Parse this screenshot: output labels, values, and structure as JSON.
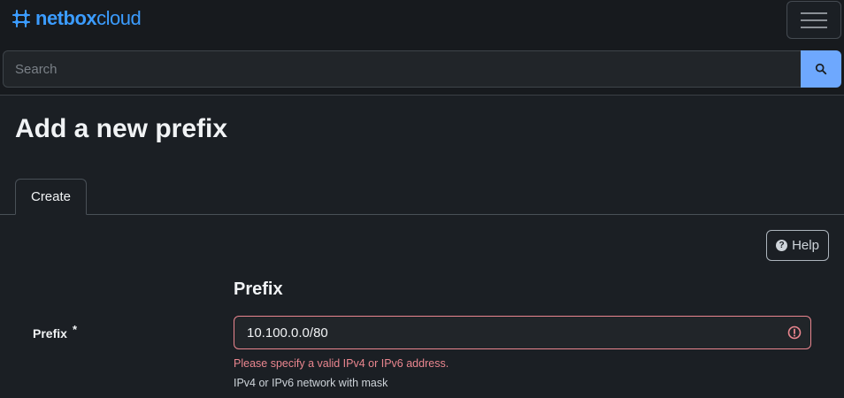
{
  "header": {
    "logo_bold": "netbox",
    "logo_light": "cloud",
    "logo_icon": "netbox-logo-icon",
    "menu_icon": "hamburger-menu-icon"
  },
  "search": {
    "placeholder": "Search",
    "value": "",
    "button_icon": "search-icon"
  },
  "page": {
    "title": "Add a new prefix"
  },
  "tabs": [
    {
      "label": "Create",
      "active": true
    }
  ],
  "help_button": {
    "label": "Help",
    "icon": "help-circle-icon"
  },
  "form": {
    "section_title": "Prefix",
    "fields": {
      "prefix": {
        "label": "Prefix",
        "required_marker": "*",
        "value": "10.100.0.0/80",
        "error": "Please specify a valid IPv4 or IPv6 address.",
        "help_text": "IPv4 or IPv6 network with mask",
        "status_icon": "error-icon"
      }
    }
  },
  "colors": {
    "accent": "#3b9cff",
    "search_button": "#6ea8fe",
    "error": "#ea868f",
    "background": "#1b1f24"
  }
}
